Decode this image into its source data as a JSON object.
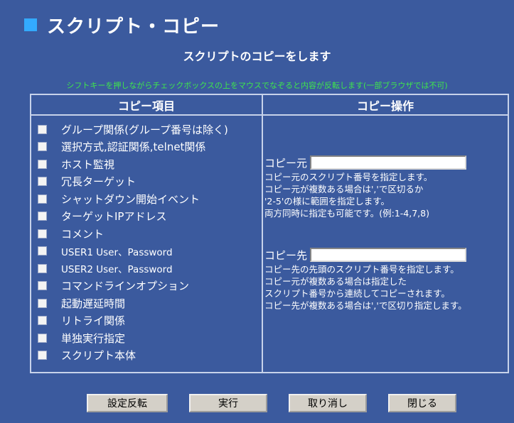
{
  "header": {
    "title": "スクリプト・コピー",
    "subtitle": "スクリプトのコピーをします",
    "hint": "シフトキーを押しながらチェックボックスの上をマウスでなぞると内容が反転します(一部ブラウザでは不可)"
  },
  "colors": {
    "background": "#3b5a9e",
    "accent": "#33aaff",
    "hint": "#3fe64c"
  },
  "table": {
    "left_header": "コピー項目",
    "right_header": "コピー操作",
    "items": [
      {
        "label": "グループ関係(グループ番号は除く)",
        "checked": false
      },
      {
        "label": "選択方式,認証関係,telnet関係",
        "checked": false
      },
      {
        "label": "ホスト監視",
        "checked": false
      },
      {
        "label": "冗長ターゲット",
        "checked": false
      },
      {
        "label": "シャットダウン開始イベント",
        "checked": false
      },
      {
        "label": "ターゲットIPアドレス",
        "checked": false
      },
      {
        "label": "コメント",
        "checked": false
      },
      {
        "label": "USER1 User、Password",
        "checked": false
      },
      {
        "label": "USER2 User、Password",
        "checked": false
      },
      {
        "label": "コマンドラインオプション",
        "checked": false
      },
      {
        "label": "起動遅延時間",
        "checked": false
      },
      {
        "label": "リトライ関係",
        "checked": false
      },
      {
        "label": "単独実行指定",
        "checked": false
      },
      {
        "label": "スクリプト本体",
        "checked": false
      }
    ]
  },
  "copy_source": {
    "label": "コピー元",
    "value": "",
    "help": [
      "コピー元のスクリプト番号を指定します。",
      "コピー元が複数ある場合は','で区切るか",
      "'2-5'の様に範囲を指定します。",
      "両方同時に指定も可能です。(例:1-4,7,8)"
    ]
  },
  "copy_dest": {
    "label": "コピー先",
    "value": "",
    "help": [
      "コピー先の先頭のスクリプト番号を指定します。",
      "コピー元が複数ある場合は指定した",
      "スクリプト番号から連続してコピーされます。",
      "コピー先が複数ある場合は','で区切り指定します。"
    ]
  },
  "buttons": {
    "invert": "設定反転",
    "execute": "実行",
    "cancel": "取り消し",
    "close": "閉じる"
  }
}
